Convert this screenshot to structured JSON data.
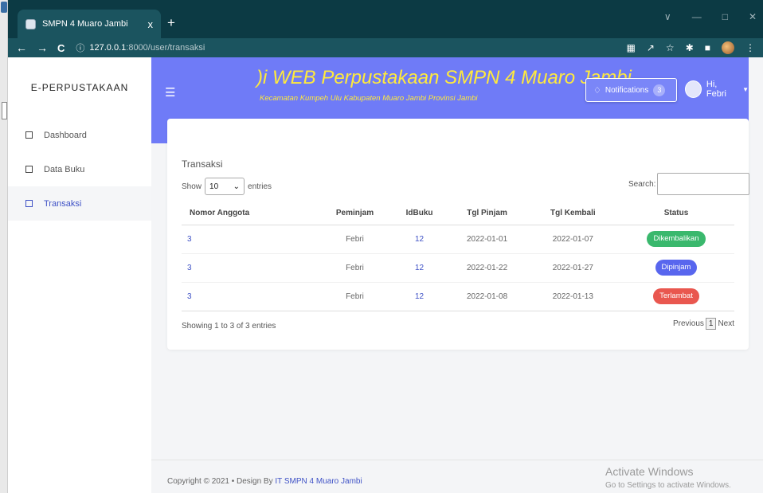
{
  "browser": {
    "tab_title": "SMPN 4 Muaro Jambi",
    "tab_close": "x",
    "new_tab": "+",
    "url_host": "127.0.0.1",
    "url_rest": ":8000/user/transaksi",
    "window_controls": [
      "∨",
      "—",
      "□",
      "✕"
    ]
  },
  "sidebar": {
    "brand": "E-PERPUSTAKAAN",
    "items": [
      {
        "label": "Dashboard",
        "active": false
      },
      {
        "label": "Data Buku",
        "active": false
      },
      {
        "label": "Transaksi",
        "active": true
      }
    ]
  },
  "header": {
    "title": ")i WEB Perpustakaan SMPN 4 Muaro Jambi",
    "subtitle": "Kecamatan Kumpeh Ulu Kabupaten Muaro Jambi Provinsi Jambi",
    "notifications_label": "Notifications",
    "notifications_count": "3",
    "user_greeting": "Hi, Febri",
    "accent_color": "#6f7bf7",
    "title_color": "#ffea3c"
  },
  "card": {
    "title": "Transaksi",
    "show_label": "Show",
    "entries_value": "10",
    "entries_label": "entries",
    "search_label": "Search:",
    "search_value": "",
    "columns": [
      "Nomor Anggota",
      "Peminjam",
      "IdBuku",
      "Tgl Pinjam",
      "Tgl Kembali",
      "Status"
    ],
    "rows": [
      {
        "nomor": "3",
        "peminjam": "Febri",
        "idbuku": "12",
        "pinjam": "2022-01-01",
        "kembali": "2022-01-07",
        "status": "Dikembalikan",
        "status_color": "#3ab86d"
      },
      {
        "nomor": "3",
        "peminjam": "Febri",
        "idbuku": "12",
        "pinjam": "2022-01-22",
        "kembali": "2022-01-27",
        "status": "Dipinjam",
        "status_color": "#5866ee"
      },
      {
        "nomor": "3",
        "peminjam": "Febri",
        "idbuku": "12",
        "pinjam": "2022-01-08",
        "kembali": "2022-01-13",
        "status": "Terlambat",
        "status_color": "#e9574f"
      }
    ],
    "info": "Showing 1 to 3 of 3 entries",
    "previous_label": "Previous",
    "current_page": "1",
    "next_label": "Next"
  },
  "footer": {
    "copyright": "Copyright © 2021 • Design By ",
    "link": "IT SMPN 4 Muaro Jambi"
  },
  "watermark": {
    "line1": "Activate Windows",
    "line2": "Go to Settings to activate Windows."
  }
}
